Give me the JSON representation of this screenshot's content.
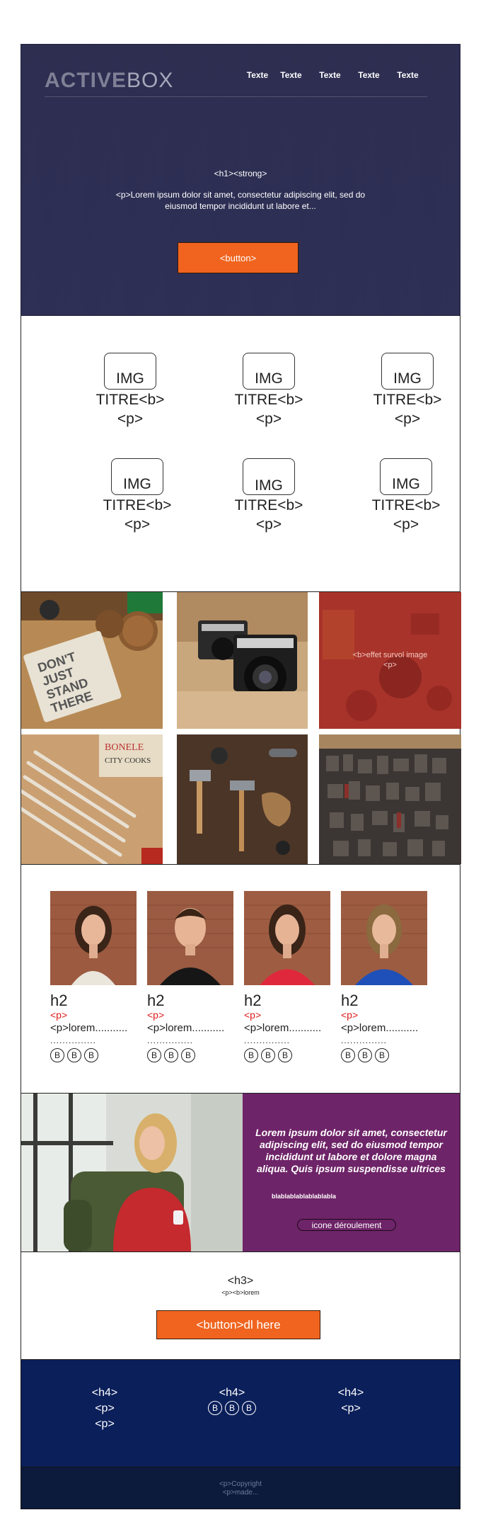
{
  "header": {
    "logo_bold": "ACTIVE",
    "logo_light": "BOX",
    "nav": [
      "Texte",
      "Texte",
      "Texte",
      "Texte",
      "Texte"
    ]
  },
  "hero": {
    "title": "<h1><strong>",
    "text": "<p>Lorem ipsum dolor sit amet, consectetur adipiscing elit, sed do eiusmod tempor incididunt ut labore et...",
    "button": "<button>"
  },
  "features": [
    {
      "img": "IMG",
      "title": "TITRE<b>",
      "text": "<p>"
    },
    {
      "img": "IMG",
      "title": "TITRE<b>",
      "text": "<p>"
    },
    {
      "img": "IMG",
      "title": "TITRE<b>",
      "text": "<p>"
    },
    {
      "img": "IMG",
      "title": "TITRE<b>",
      "text": "<p>"
    },
    {
      "img": "IMG",
      "title": "TITRE<b>",
      "text": "<p>"
    },
    {
      "img": "IMG",
      "title": "TITRE<b>",
      "text": "<p>"
    }
  ],
  "gallery": {
    "hover_title": "<b>effet survol image",
    "hover_text": "<p>"
  },
  "team": [
    {
      "h2": "h2",
      "red": "<p>",
      "text": "<p>lorem...........",
      "dots": "...............",
      "socials": [
        "B",
        "B",
        "B"
      ]
    },
    {
      "h2": "h2",
      "red": "<p>",
      "text": "<p>lorem...........",
      "dots": "...............",
      "socials": [
        "B",
        "B",
        "B"
      ]
    },
    {
      "h2": "h2",
      "red": "<p>",
      "text": "<p>lorem...........",
      "dots": "...............",
      "socials": [
        "B",
        "B",
        "B"
      ]
    },
    {
      "h2": "h2",
      "red": "<p>",
      "text": "<p>lorem...........",
      "dots": "...............",
      "socials": [
        "B",
        "B",
        "B"
      ]
    }
  ],
  "testimonial": {
    "quote": "Lorem ipsum dolor sit amet, consectetur adipiscing elit, sed do eiusmod tempor incididunt ut labore et dolore magna aliqua. Quis ipsum suspendisse ultrices",
    "small": "blablablablablablabla",
    "button": "icone déroulement"
  },
  "cta": {
    "title": "<h3>",
    "subtitle": "<p><b>lorem",
    "button": "<button>dl here"
  },
  "footer": {
    "col1": [
      "<h4>",
      "<p>",
      "<p>"
    ],
    "col2_title": "<h4>",
    "col2_socials": [
      "B",
      "B",
      "B"
    ],
    "col3": [
      "<h4>",
      "<p>"
    ],
    "copyright": "<p>Copyright",
    "made": "<p>made..."
  },
  "colors": {
    "accent_orange": "#f0641f",
    "hero_bg": "#2f3154",
    "purple": "#6e2468",
    "footer_navy": "#0b1f5a",
    "red_text": "#e01b1b"
  }
}
